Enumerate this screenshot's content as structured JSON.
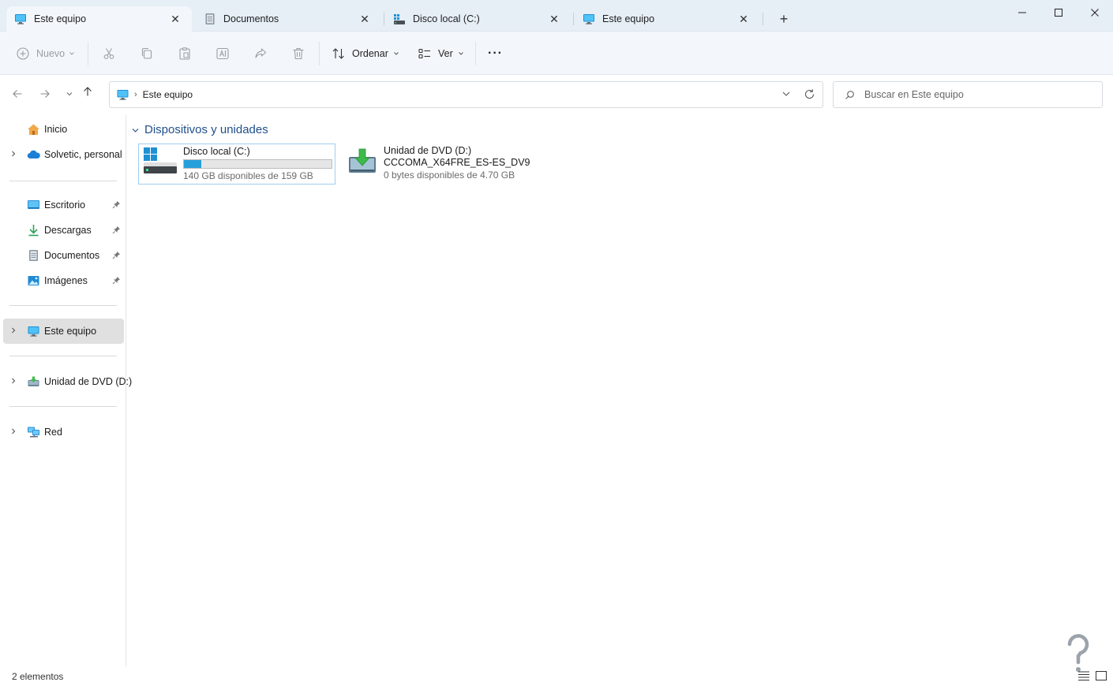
{
  "tabs": [
    {
      "label": "Este equipo",
      "icon": "monitor-icon",
      "active": true
    },
    {
      "label": "Documentos",
      "icon": "document-icon",
      "active": false
    },
    {
      "label": "Disco local (C:)",
      "icon": "drive-icon",
      "active": false
    },
    {
      "label": "Este equipo",
      "icon": "monitor-icon",
      "active": false
    }
  ],
  "window_controls": {
    "minimize": "—",
    "maximize": "☐",
    "close": "✕",
    "new_tab": "+"
  },
  "toolbar": {
    "new_label": "Nuevo",
    "sort_label": "Ordenar",
    "view_label": "Ver",
    "more_label": "···"
  },
  "address": {
    "crumb": "Este equipo"
  },
  "search": {
    "placeholder": "Buscar en Este equipo"
  },
  "sidebar": {
    "home": "Inicio",
    "onedrive": "Solvetic, personal",
    "quick_access": [
      {
        "label": "Escritorio",
        "icon": "desktop-icon"
      },
      {
        "label": "Descargas",
        "icon": "download-icon"
      },
      {
        "label": "Documentos",
        "icon": "document-icon"
      },
      {
        "label": "Imágenes",
        "icon": "pictures-icon"
      }
    ],
    "this_pc": "Este equipo",
    "dvd": "Unidad de DVD (D:)",
    "network": "Red"
  },
  "main": {
    "section_title": "Dispositivos y unidades",
    "drives": [
      {
        "name": "Disco local (C:)",
        "space": "140 GB disponibles de 159 GB",
        "used_fraction": 0.12
      },
      {
        "name": "Unidad de DVD (D:)",
        "volume_label": "CCCOMA_X64FRE_ES-ES_DV9",
        "space": "0 bytes disponibles de 4.70 GB"
      }
    ]
  },
  "status": {
    "item_count": "2 elementos"
  },
  "colors": {
    "accent": "#26a0da",
    "section_title": "#1f4f8b",
    "titlebar": "#e6eef6",
    "commandbar": "#f3f7fb",
    "selection": "#e0e0e0"
  }
}
